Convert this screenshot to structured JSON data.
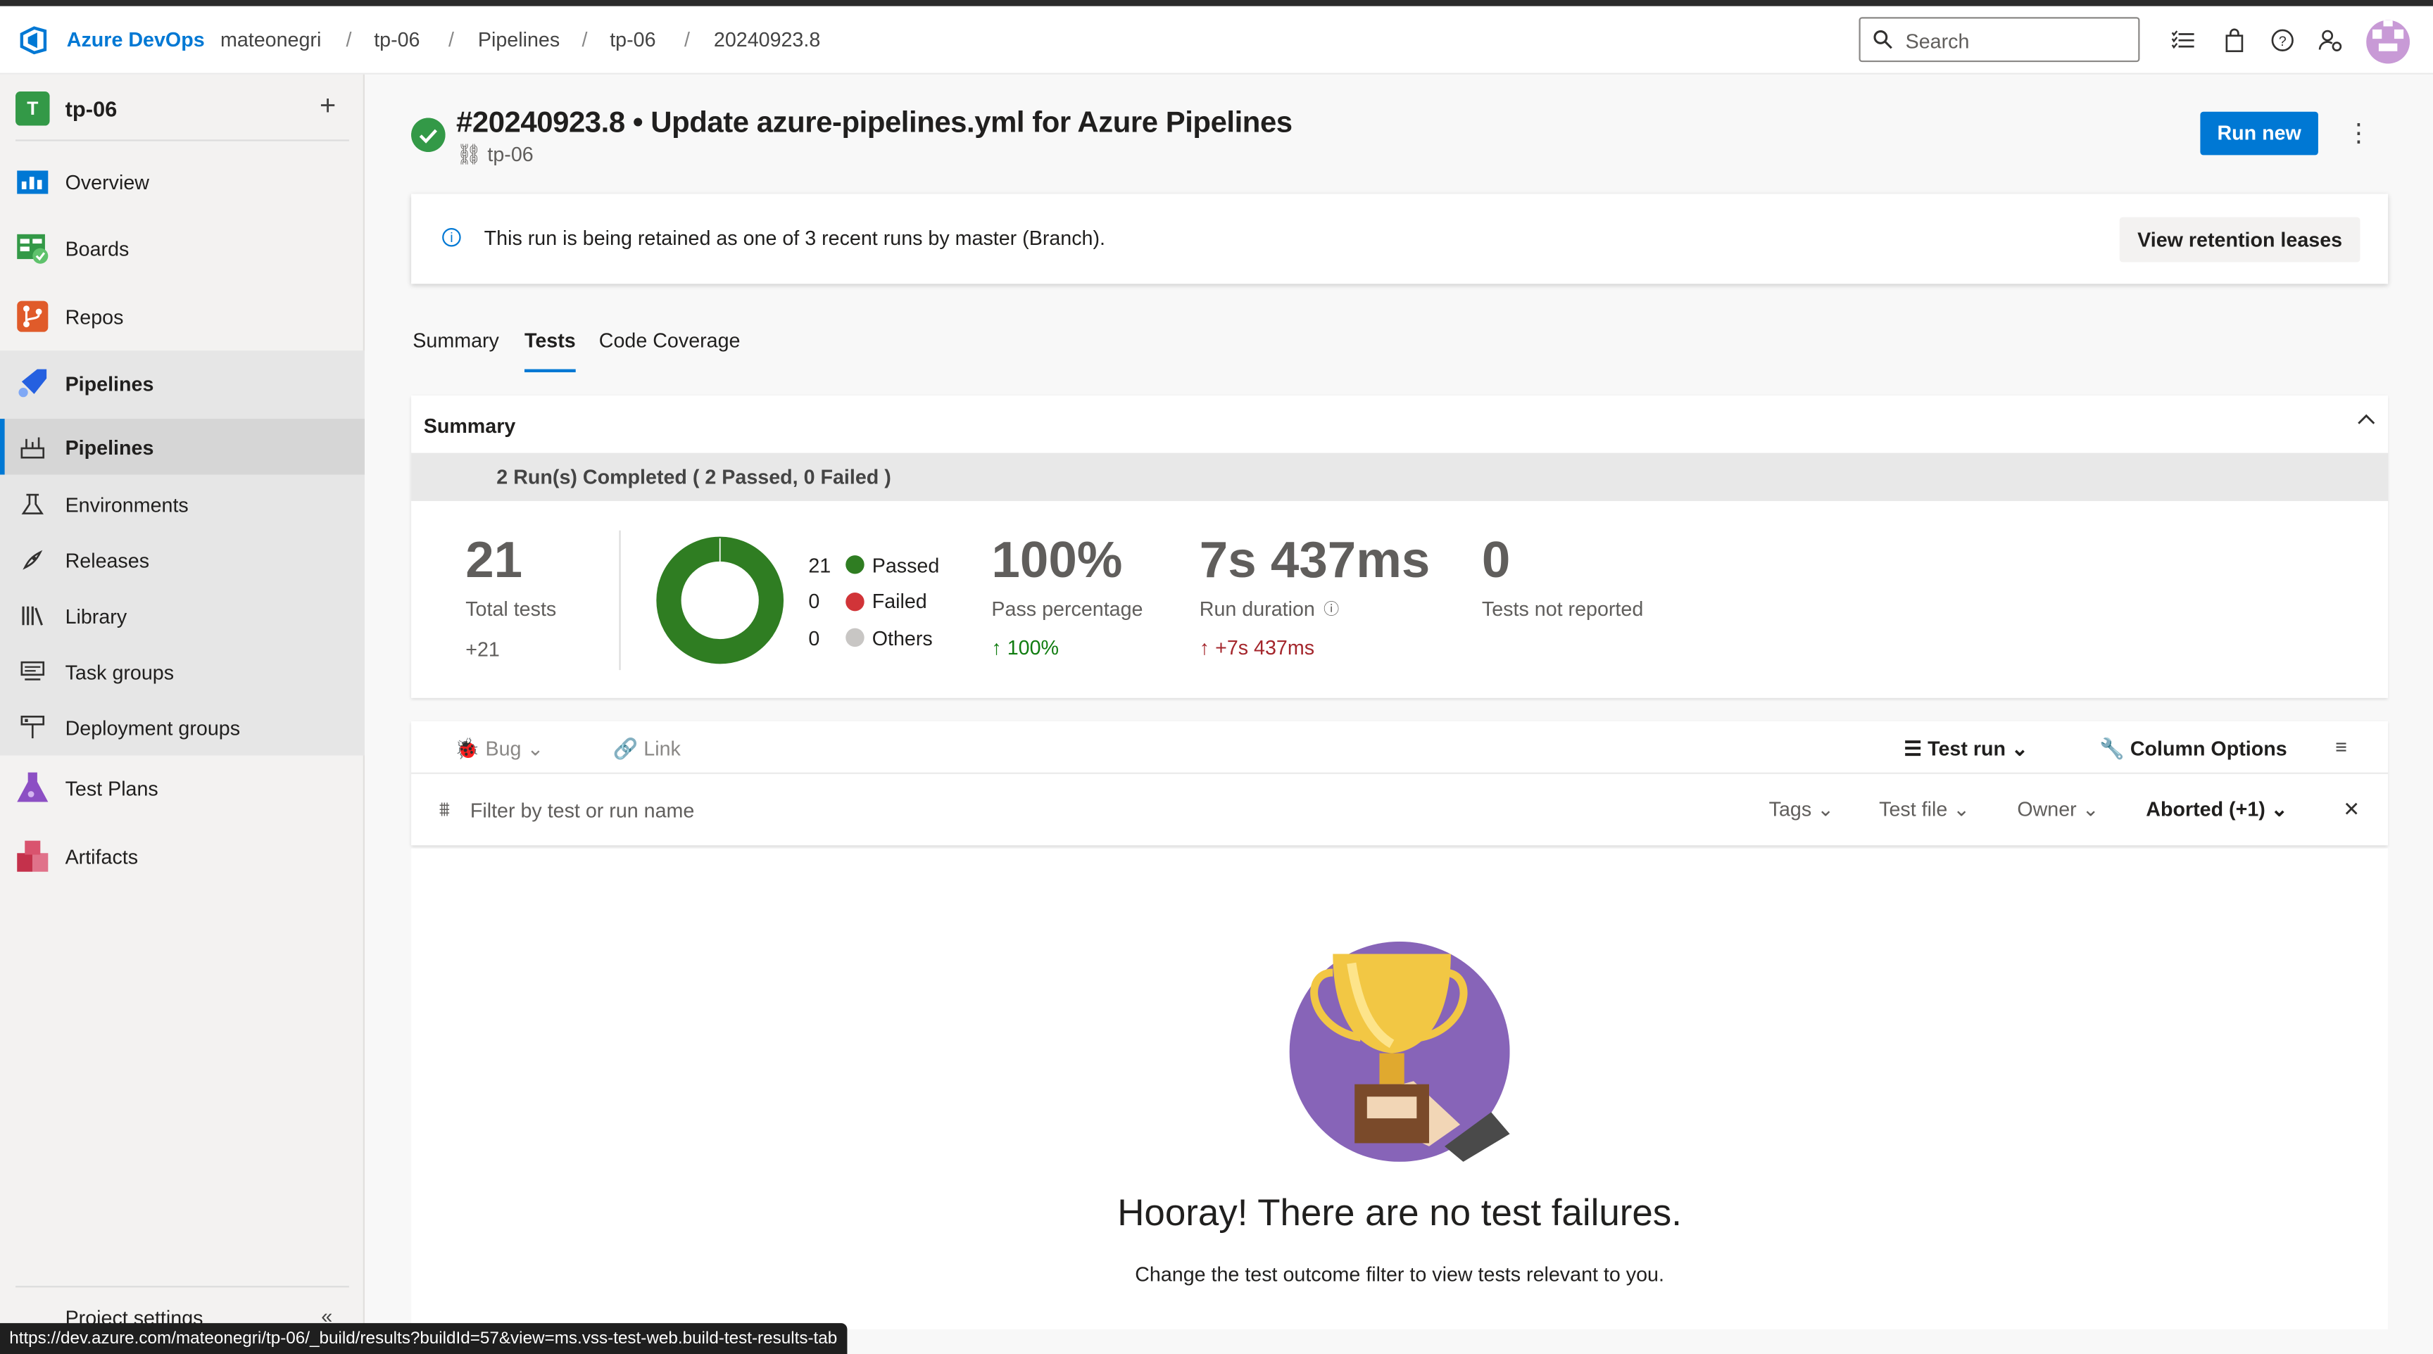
{
  "topbar": {
    "brand": "Azure DevOps",
    "breadcrumbs": [
      "mateonegri",
      "tp-06",
      "Pipelines",
      "tp-06",
      "20240923.8"
    ],
    "search_placeholder": "Search"
  },
  "sidebar": {
    "project_initial": "T",
    "project_name": "tp-06",
    "items": [
      {
        "label": "Overview",
        "icon": "overview-icon"
      },
      {
        "label": "Boards",
        "icon": "boards-icon"
      },
      {
        "label": "Repos",
        "icon": "repos-icon"
      },
      {
        "label": "Pipelines",
        "icon": "pipelines-icon"
      }
    ],
    "pipeline_subitems": [
      {
        "label": "Pipelines",
        "icon": "pipeline-list-icon"
      },
      {
        "label": "Environments",
        "icon": "environments-icon"
      },
      {
        "label": "Releases",
        "icon": "releases-icon"
      },
      {
        "label": "Library",
        "icon": "library-icon"
      },
      {
        "label": "Task groups",
        "icon": "task-groups-icon"
      },
      {
        "label": "Deployment groups",
        "icon": "deployment-groups-icon"
      }
    ],
    "bottom_items": [
      {
        "label": "Test Plans",
        "icon": "test-plans-icon"
      },
      {
        "label": "Artifacts",
        "icon": "artifacts-icon"
      }
    ],
    "project_settings": "Project settings"
  },
  "run": {
    "title": "#20240923.8 • Update azure-pipelines.yml for Azure Pipelines",
    "pipeline_name": "tp-06",
    "run_new_label": "Run new",
    "status": "succeeded"
  },
  "banner": {
    "text": "This run is being retained as one of 3 recent runs by master (Branch).",
    "button": "View retention leases"
  },
  "tabs": [
    {
      "label": "Summary",
      "active": false
    },
    {
      "label": "Tests",
      "active": true
    },
    {
      "label": "Code Coverage",
      "active": false
    }
  ],
  "summary": {
    "heading": "Summary",
    "runs_completed": "2 Run(s) Completed ( 2 Passed, 0 Failed )",
    "total_tests": "21",
    "total_tests_label": "Total tests",
    "total_delta": "+21",
    "legend": [
      {
        "count": "21",
        "label": "Passed",
        "color": "#2f7d22"
      },
      {
        "count": "0",
        "label": "Failed",
        "color": "#d13438"
      },
      {
        "count": "0",
        "label": "Others",
        "color": "#c8c6c4"
      }
    ],
    "pass_percentage": "100%",
    "pass_percentage_label": "Pass percentage",
    "pass_delta": "100%",
    "run_duration": "7s 437ms",
    "run_duration_label": "Run duration",
    "duration_delta": "+7s 437ms",
    "not_reported": "0",
    "not_reported_label": "Tests not reported"
  },
  "toolbar": {
    "bug": "Bug",
    "link": "Link",
    "test_run": "Test run",
    "column_options": "Column Options",
    "filter_placeholder": "Filter by test or run name",
    "filters": [
      "Tags",
      "Test file",
      "Owner"
    ],
    "outcome_filter": "Aborted (+1)"
  },
  "empty_state": {
    "headline": "Hooray! There are no test failures.",
    "hint": "Change the test outcome filter to view tests relevant to you."
  },
  "status_url": "https://dev.azure.com/mateonegri/tp-06/_build/results?buildId=57&view=ms.vss-test-web.build-test-results-tab",
  "colors": {
    "accent": "#0078d4",
    "success": "#339947",
    "passed": "#2f7d22",
    "failed": "#d13438"
  }
}
